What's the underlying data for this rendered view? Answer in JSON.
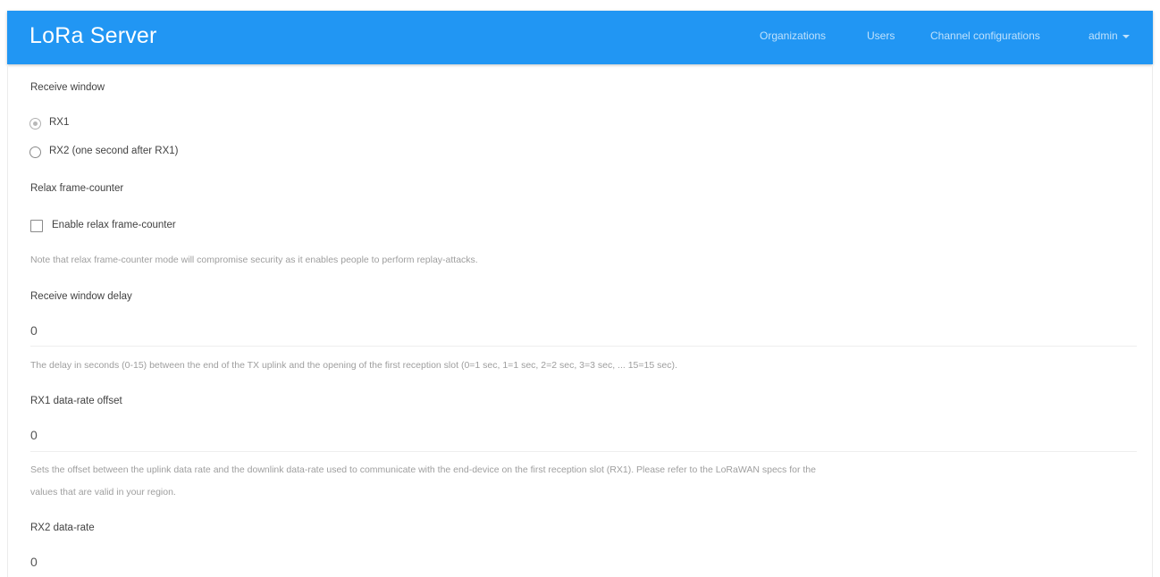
{
  "header": {
    "brand": "LoRa Server",
    "nav": {
      "organizations": "Organizations",
      "users": "Users",
      "channel_configurations": "Channel configurations",
      "admin": "admin"
    },
    "bar_color": "#2196f3"
  },
  "form": {
    "receive_window": {
      "label": "Receive window",
      "options": [
        {
          "label": "RX1",
          "checked": true
        },
        {
          "label": "RX2 (one second after RX1)",
          "checked": false
        }
      ]
    },
    "relax_frame_counter": {
      "label": "Relax frame-counter",
      "checkbox_label": "Enable relax frame-counter",
      "checked": false,
      "help": "Note that relax frame-counter mode will compromise security as it enables people to perform replay-attacks."
    },
    "receive_window_delay": {
      "label": "Receive window delay",
      "value": "0",
      "help": "The delay in seconds (0-15) between the end of the TX uplink and the opening of the first reception slot (0=1 sec, 1=1 sec, 2=2 sec, 3=3 sec, ... 15=15 sec)."
    },
    "rx1_data_rate_offset": {
      "label": "RX1 data-rate offset",
      "value": "0",
      "help_line1": "Sets the offset between the uplink data rate and the downlink data-rate used to communicate with the end-device on the first reception slot (RX1). Please refer to the LoRaWAN specs for the",
      "help_line2": "values that are valid in your region."
    },
    "rx2_data_rate": {
      "label": "RX2 data-rate",
      "value": "0"
    }
  }
}
